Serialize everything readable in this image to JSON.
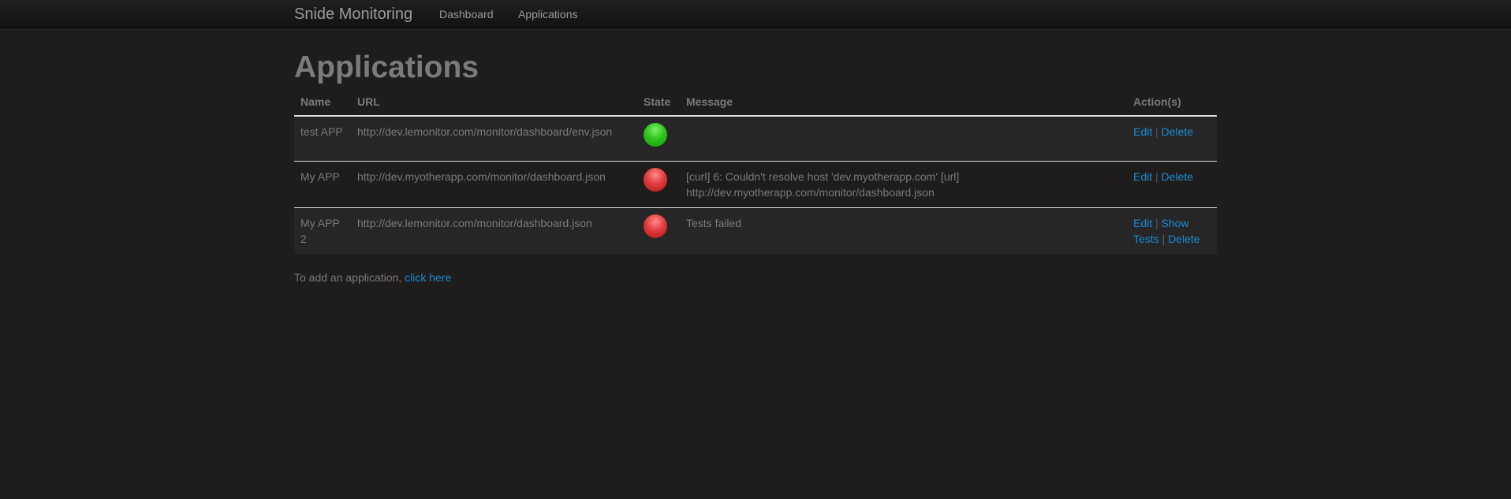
{
  "navbar": {
    "brand": "Snide Monitoring",
    "links": [
      "Dashboard",
      "Applications"
    ]
  },
  "page_title": "Applications",
  "table": {
    "headers": [
      "Name",
      "URL",
      "State",
      "Message",
      "Action(s)"
    ],
    "rows": [
      {
        "name": "test APP",
        "url": "http://dev.lemonitor.com/monitor/dashboard/env.json",
        "state": "ok",
        "message": "",
        "actions": [
          "Edit",
          "Delete"
        ]
      },
      {
        "name": "My APP",
        "url": "http://dev.myotherapp.com/monitor/dashboard.json",
        "state": "error",
        "message": "[curl] 6: Couldn't resolve host 'dev.myotherapp.com' [url] http://dev.myotherapp.com/monitor/dashboard.json",
        "actions": [
          "Edit",
          "Delete"
        ]
      },
      {
        "name": "My APP 2",
        "url": "http://dev.lemonitor.com/monitor/dashboard.json",
        "state": "error",
        "message": "Tests failed",
        "actions": [
          "Edit",
          "Show Tests",
          "Delete"
        ]
      }
    ]
  },
  "footer": {
    "text": "To add an application, ",
    "link": "click here"
  },
  "separator": "|",
  "colors": {
    "link": "#1a8cd6",
    "ok": "#2fc41c",
    "error": "#e23c3c"
  }
}
